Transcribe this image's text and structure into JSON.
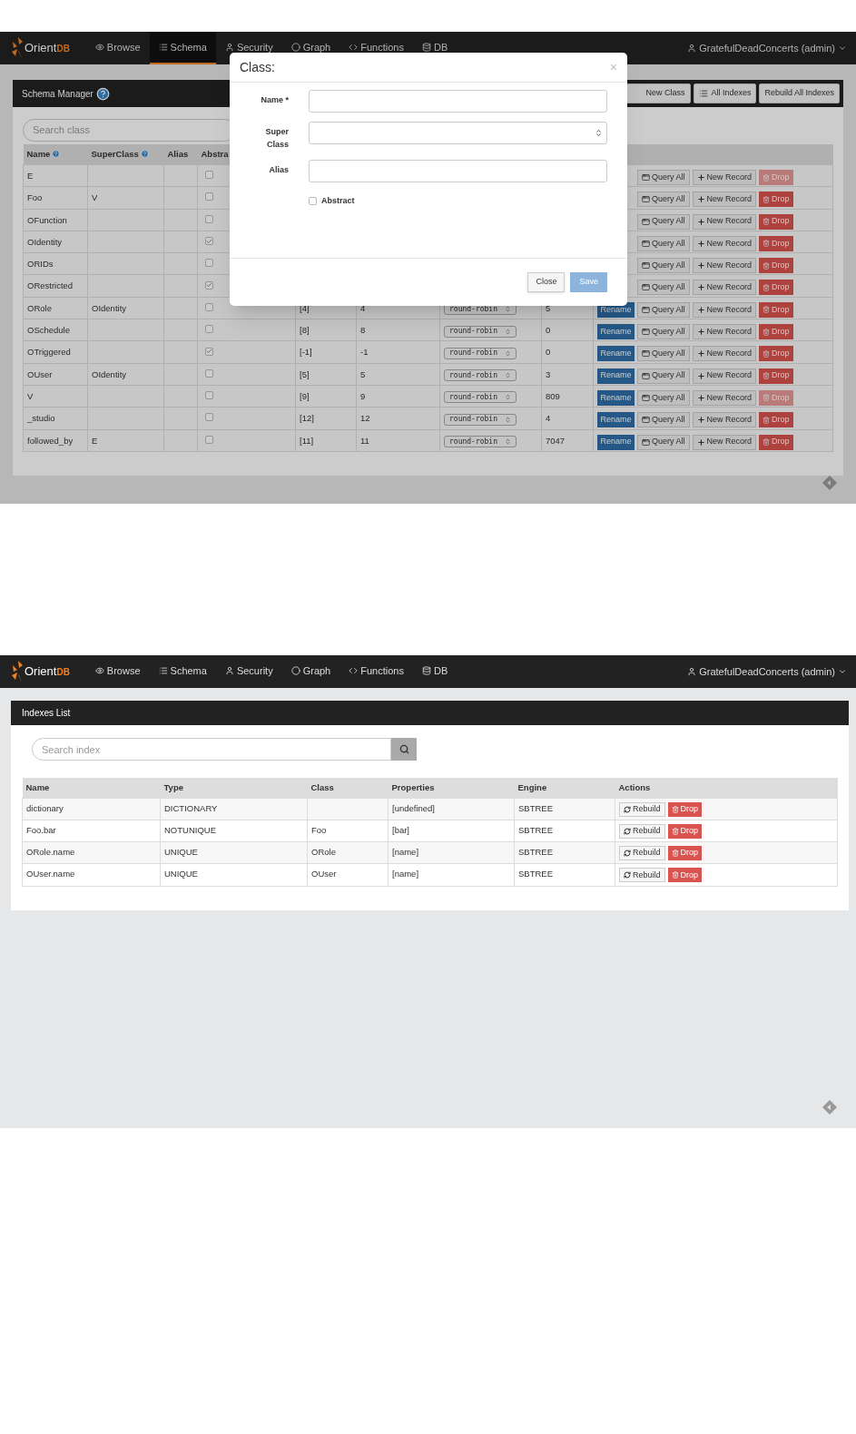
{
  "schema_screen": {
    "navbar": {
      "logo": {
        "text": "Orient",
        "accent": "DB"
      },
      "items": [
        {
          "label": "Browse",
          "selected": false
        },
        {
          "label": "Schema",
          "selected": true
        },
        {
          "label": "Security",
          "selected": false
        },
        {
          "label": "Graph",
          "selected": false
        },
        {
          "label": "Functions",
          "selected": false
        },
        {
          "label": "DB",
          "selected": false
        }
      ],
      "user": "GratefulDeadConcerts (admin)"
    },
    "panel_title": "Schema Manager",
    "toolbar_buttons": [
      "New Class",
      "All Indexes",
      "Rebuild All Indexes"
    ],
    "search": {
      "placeholder": "Search class"
    },
    "columns": [
      "Name",
      "SuperClass",
      "Alias",
      "Abstra"
    ],
    "rows": [
      {
        "name": "E",
        "superclass": "",
        "abstract": false,
        "query": "Query All",
        "new_record": "New Record",
        "drop": "Drop",
        "drop_disabled": true
      },
      {
        "name": "Foo",
        "superclass": "V",
        "abstract": false,
        "query": "Query All",
        "new_record": "New Record",
        "drop": "Drop",
        "drop_disabled": false
      },
      {
        "name": "OFunction",
        "superclass": "",
        "abstract": false,
        "query": "Query All",
        "new_record": "New Record",
        "drop": "Drop",
        "drop_disabled": false
      },
      {
        "name": "OIdentity",
        "superclass": "",
        "abstract": true,
        "query": "Query All",
        "new_record": "New Record",
        "drop": "Drop",
        "drop_disabled": false
      },
      {
        "name": "ORIDs",
        "superclass": "",
        "abstract": false,
        "query": "Query All",
        "new_record": "New Record",
        "drop": "Drop",
        "drop_disabled": false
      },
      {
        "name": "ORestricted",
        "superclass": "",
        "abstract": true,
        "query": "Query All",
        "new_record": "New Record",
        "drop": "Drop",
        "drop_disabled": false
      },
      {
        "name": "ORole",
        "superclass": "OIdentity",
        "abstract": false,
        "clusters": "[4]",
        "default_cluster": "4",
        "selection": "round-robin",
        "records": "5",
        "rename": "Rename",
        "query": "Query All",
        "new_record": "New Record",
        "drop": "Drop",
        "drop_disabled": false
      },
      {
        "name": "OSchedule",
        "superclass": "",
        "abstract": false,
        "clusters": "[8]",
        "default_cluster": "8",
        "selection": "round-robin",
        "records": "0",
        "rename": "Rename",
        "query": "Query All",
        "new_record": "New Record",
        "drop": "Drop",
        "drop_disabled": false
      },
      {
        "name": "OTriggered",
        "superclass": "",
        "abstract": true,
        "clusters": "[-1]",
        "default_cluster": "-1",
        "selection": "round-robin",
        "records": "0",
        "rename": "Rename",
        "query": "Query All",
        "new_record": "New Record",
        "drop": "Drop",
        "drop_disabled": false
      },
      {
        "name": "OUser",
        "superclass": "OIdentity",
        "abstract": false,
        "clusters": "[5]",
        "default_cluster": "5",
        "selection": "round-robin",
        "records": "3",
        "rename": "Rename",
        "query": "Query All",
        "new_record": "New Record",
        "drop": "Drop",
        "drop_disabled": false
      },
      {
        "name": "V",
        "superclass": "",
        "abstract": false,
        "clusters": "[9]",
        "default_cluster": "9",
        "selection": "round-robin",
        "records": "809",
        "rename": "Rename",
        "query": "Query All",
        "new_record": "New Record",
        "drop": "Drop",
        "drop_disabled": true
      },
      {
        "name": "_studio",
        "superclass": "",
        "abstract": false,
        "clusters": "[12]",
        "default_cluster": "12",
        "selection": "round-robin",
        "records": "4",
        "rename": "Rename",
        "query": "Query All",
        "new_record": "New Record",
        "drop": "Drop",
        "drop_disabled": false
      },
      {
        "name": "followed_by",
        "superclass": "E",
        "abstract": false,
        "clusters": "[11]",
        "default_cluster": "11",
        "selection": "round-robin",
        "records": "7047",
        "rename": "Rename",
        "query": "Query All",
        "new_record": "New Record",
        "drop": "Drop",
        "drop_disabled": false
      }
    ],
    "modal": {
      "title": "Class:",
      "close": "×",
      "fields": [
        {
          "label": "Name *",
          "kind": "text"
        },
        {
          "label": "Super Class",
          "kind": "select"
        },
        {
          "label": "Alias",
          "kind": "text"
        }
      ],
      "checkbox": {
        "label": "Abstract",
        "checked": false
      },
      "close_button": "Close",
      "save_button": {
        "label": "Save",
        "disabled": true
      }
    }
  },
  "indexes_screen": {
    "navbar": {
      "logo": {
        "text": "Orient",
        "accent": "DB"
      },
      "items": [
        {
          "label": "Browse",
          "selected": false
        },
        {
          "label": "Schema",
          "selected": false
        },
        {
          "label": "Security",
          "selected": false
        },
        {
          "label": "Graph",
          "selected": false
        },
        {
          "label": "Functions",
          "selected": false
        },
        {
          "label": "DB",
          "selected": false
        }
      ],
      "user": "GratefulDeadConcerts (admin)"
    },
    "panel_title": "Indexes List",
    "search": {
      "placeholder": "Search index"
    },
    "columns": [
      "Name",
      "Type",
      "Class",
      "Properties",
      "Engine",
      "Actions"
    ],
    "rows": [
      {
        "name": "dictionary",
        "type": "DICTIONARY",
        "class": "",
        "properties": "[undefined]",
        "engine": "SBTREE",
        "rebuild": "Rebuild",
        "drop": "Drop"
      },
      {
        "name": "Foo.bar",
        "type": "NOTUNIQUE",
        "class": "Foo",
        "properties": "[bar]",
        "engine": "SBTREE",
        "rebuild": "Rebuild",
        "drop": "Drop"
      },
      {
        "name": "ORole.name",
        "type": "UNIQUE",
        "class": "ORole",
        "properties": "[name]",
        "engine": "SBTREE",
        "rebuild": "Rebuild",
        "drop": "Drop"
      },
      {
        "name": "OUser.name",
        "type": "UNIQUE",
        "class": "OUser",
        "properties": "[name]",
        "engine": "SBTREE",
        "rebuild": "Rebuild",
        "drop": "Drop"
      }
    ]
  }
}
